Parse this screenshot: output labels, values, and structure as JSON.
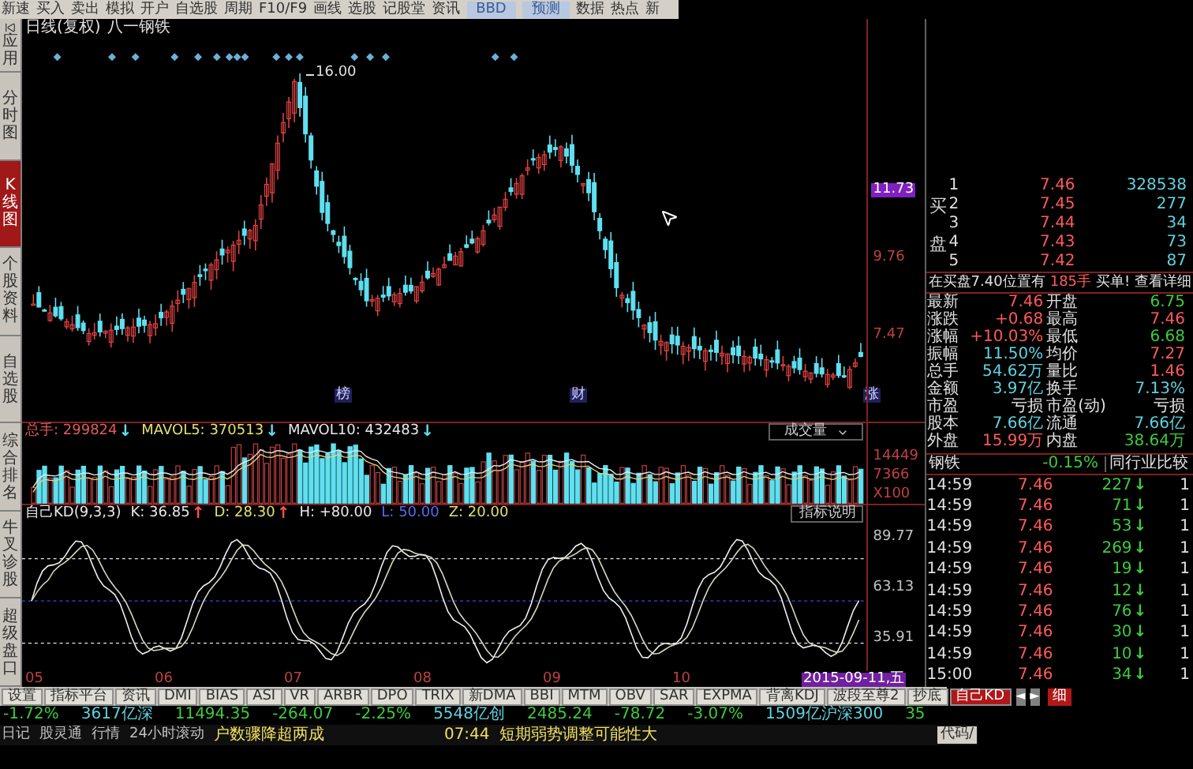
{
  "menu_bar": {
    "items": [
      {
        "label": "新速",
        "kind": "text"
      },
      {
        "label": "买入",
        "kind": "text"
      },
      {
        "label": "卖出",
        "kind": "text"
      },
      {
        "label": "模拟",
        "kind": "text"
      },
      {
        "label": "开户",
        "kind": "text"
      },
      {
        "label": "自选股",
        "kind": "text"
      },
      {
        "label": "周期",
        "kind": "text"
      },
      {
        "label": "F10/F9",
        "kind": "text"
      },
      {
        "label": "画线",
        "kind": "text"
      },
      {
        "label": "选股",
        "kind": "text"
      },
      {
        "label": "记股堂",
        "kind": "text"
      },
      {
        "label": "资讯",
        "kind": "text"
      },
      {
        "label": "BBD",
        "kind": "button"
      },
      {
        "label": "预测",
        "kind": "button"
      },
      {
        "label": "数据",
        "kind": "text"
      },
      {
        "label": "热点",
        "kind": "text"
      },
      {
        "label": "新",
        "kind": "text"
      }
    ]
  },
  "sidebar": {
    "items": [
      {
        "label": "应用",
        "selected": false
      },
      {
        "label": "分时图",
        "selected": false
      },
      {
        "label": "K线图",
        "selected": true
      },
      {
        "label": "个股资料",
        "selected": false
      },
      {
        "label": "自选股",
        "selected": false
      },
      {
        "label": "综合排名",
        "selected": false
      },
      {
        "label": "牛叉诊股",
        "selected": false
      },
      {
        "label": "超级盘口",
        "selected": false
      }
    ]
  },
  "chart": {
    "title": "日线(复权)",
    "stock": "八一钢铁",
    "peak_label": "16.00",
    "price_axis": [
      {
        "label": "11.73",
        "highlighted": true
      },
      {
        "label": "9.76",
        "highlighted": false
      },
      {
        "label": "7.47",
        "highlighted": false
      }
    ],
    "event_markers": [
      "榜",
      "财",
      "涨"
    ]
  },
  "volume": {
    "fields": [
      {
        "label": "总手:",
        "value": "299824",
        "arrow": "↓",
        "color": "#e05a5a"
      },
      {
        "label": "MAVOL5:",
        "value": "370513",
        "arrow": "↓",
        "color": "#e0e070"
      },
      {
        "label": "MAVOL10:",
        "value": "432483",
        "arrow": "↓",
        "color": "#e8e8e8"
      }
    ],
    "dropdown": "成交量",
    "axis": [
      "14449",
      "7366",
      "X100"
    ]
  },
  "indicator": {
    "name": "自己KD(9,3,3)",
    "fields": [
      {
        "label": "K:",
        "value": "36.85",
        "arrow": "↑",
        "color": "#e8e8e8"
      },
      {
        "label": "D:",
        "value": "28.30",
        "arrow": "↑",
        "color": "#e0e070"
      },
      {
        "label": "H:",
        "value": "+80.00",
        "color": "#e8e8e8"
      },
      {
        "label": "L:",
        "value": "50.00",
        "color": "#5a6af0"
      },
      {
        "label": "Z:",
        "value": "20.00",
        "color": "#e0e070"
      }
    ],
    "help_button": "指标说明",
    "axis": [
      "89.77",
      "63.13",
      "35.91"
    ]
  },
  "x_axis": {
    "labels": [
      "05",
      "06",
      "07",
      "08",
      "09",
      "10"
    ],
    "cursor_date": "2015-09-11,五"
  },
  "indicator_tabs": [
    {
      "label": "设置",
      "selected": false
    },
    {
      "label": "指标平台",
      "selected": false
    },
    {
      "label": "资讯",
      "selected": false
    },
    {
      "label": "DMI",
      "selected": false
    },
    {
      "label": "BIAS",
      "selected": false
    },
    {
      "label": "ASI",
      "selected": false
    },
    {
      "label": "VR",
      "selected": false
    },
    {
      "label": "ARBR",
      "selected": false
    },
    {
      "label": "DPO",
      "selected": false
    },
    {
      "label": "TRIX",
      "selected": false
    },
    {
      "label": "新DMA",
      "selected": false
    },
    {
      "label": "BBI",
      "selected": false
    },
    {
      "label": "MTM",
      "selected": false
    },
    {
      "label": "OBV",
      "selected": false
    },
    {
      "label": "SAR",
      "selected": false
    },
    {
      "label": "EXPMA",
      "selected": false
    },
    {
      "label": "背离KDJ",
      "selected": false
    },
    {
      "label": "波段至尊2",
      "selected": false
    },
    {
      "label": "抄底",
      "selected": false
    },
    {
      "label": "自己KD",
      "selected": true
    }
  ],
  "nav_buttons": [
    "◄",
    "►"
  ],
  "detail_tab": "细",
  "ticker": [
    {
      "text": "-1.72%",
      "color": "#3ccc3c"
    },
    {
      "text": "3617亿深",
      "color": "#5fd3e0"
    },
    {
      "text": "11494.35",
      "color": "#3ccc3c"
    },
    {
      "text": "-264.07",
      "color": "#3ccc3c"
    },
    {
      "text": "-2.25%",
      "color": "#3ccc3c"
    },
    {
      "text": "5548亿创",
      "color": "#5fd3e0"
    },
    {
      "text": "2485.24",
      "color": "#3ccc3c"
    },
    {
      "text": "-78.72",
      "color": "#3ccc3c"
    },
    {
      "text": "-3.07%",
      "color": "#3ccc3c"
    },
    {
      "text": "1509亿沪深300",
      "color": "#5fd3e0"
    },
    {
      "text": "35",
      "color": "#3ccc3c"
    }
  ],
  "news_bar": {
    "items": [
      "日记",
      "股灵通",
      "行情",
      "24小时滚动"
    ],
    "headline": "户数骤降超两成",
    "time": "07:44",
    "headline_2": "短期弱势调整可能性大",
    "code_button": "代码/"
  },
  "quote": {
    "bid_label": "买盘",
    "bids": [
      {
        "rank": "1",
        "price": "7.46",
        "volume": "328538"
      },
      {
        "rank": "2",
        "price": "7.45",
        "volume": "277"
      },
      {
        "rank": "3",
        "price": "7.44",
        "volume": "34"
      },
      {
        "rank": "4",
        "price": "7.43",
        "volume": "73"
      },
      {
        "rank": "5",
        "price": "7.42",
        "volume": "87"
      }
    ],
    "order_note": {
      "text": "在买盘7.40位置有",
      "qty": "185手",
      "link": "买单! 查看详细"
    },
    "stats": [
      {
        "label": "最新",
        "value": "7.46",
        "color": "#ff5a5a"
      },
      {
        "label": "开盘",
        "value": "6.75",
        "color": "#3ccc3c"
      },
      {
        "label": "涨跌",
        "value": "+0.68",
        "color": "#ff5a5a"
      },
      {
        "label": "最高",
        "value": "7.46",
        "color": "#ff5a5a"
      },
      {
        "label": "涨幅",
        "value": "+10.03%",
        "color": "#ff5a5a"
      },
      {
        "label": "最低",
        "value": "6.68",
        "color": "#3ccc3c"
      },
      {
        "label": "振幅",
        "value": "11.50%",
        "color": "#5fd3e0"
      },
      {
        "label": "均价",
        "value": "7.27",
        "color": "#ff5a5a"
      },
      {
        "label": "总手",
        "value": "54.62万",
        "color": "#5fd3e0"
      },
      {
        "label": "量比",
        "value": "1.46",
        "color": "#ff5a5a"
      },
      {
        "label": "金额",
        "value": "3.97亿",
        "color": "#5fd3e0"
      },
      {
        "label": "换手",
        "value": "7.13%",
        "color": "#5fd3e0"
      },
      {
        "label": "市盈",
        "value": "亏损",
        "color": "#e8e8e8"
      },
      {
        "label": "市盈(动)",
        "value": "亏损",
        "color": "#e8e8e8"
      },
      {
        "label": "股本",
        "value": "7.66亿",
        "color": "#5fd3e0"
      },
      {
        "label": "流通",
        "value": "7.66亿",
        "color": "#5fd3e0"
      },
      {
        "label": "外盘",
        "value": "15.99万",
        "color": "#ff5a5a"
      },
      {
        "label": "内盘",
        "value": "38.64万",
        "color": "#3ccc3c"
      }
    ],
    "sector": {
      "name": "钢铁",
      "change": "-0.15%",
      "button": "同行业比较"
    },
    "ticks": [
      {
        "time": "14:59",
        "price": "7.46",
        "volume": "227",
        "arrow": "↓",
        "column_4": "1"
      },
      {
        "time": "14:59",
        "price": "7.46",
        "volume": "71",
        "arrow": "↓",
        "column_4": "1"
      },
      {
        "time": "14:59",
        "price": "7.46",
        "volume": "53",
        "arrow": "↓",
        "column_4": "1"
      },
      {
        "time": "14:59",
        "price": "7.46",
        "volume": "269",
        "arrow": "↓",
        "column_4": "1"
      },
      {
        "time": "14:59",
        "price": "7.46",
        "volume": "19",
        "arrow": "↓",
        "column_4": "1"
      },
      {
        "time": "14:59",
        "price": "7.46",
        "volume": "12",
        "arrow": "↓",
        "column_4": "1"
      },
      {
        "time": "14:59",
        "price": "7.46",
        "volume": "76",
        "arrow": "↓",
        "column_4": "1"
      },
      {
        "time": "14:59",
        "price": "7.46",
        "volume": "30",
        "arrow": "↓",
        "column_4": "1"
      },
      {
        "time": "14:59",
        "price": "7.46",
        "volume": "10",
        "arrow": "↓",
        "column_4": "1"
      },
      {
        "time": "15:00",
        "price": "7.46",
        "volume": "34",
        "arrow": "↓",
        "column_4": "1"
      }
    ]
  }
}
